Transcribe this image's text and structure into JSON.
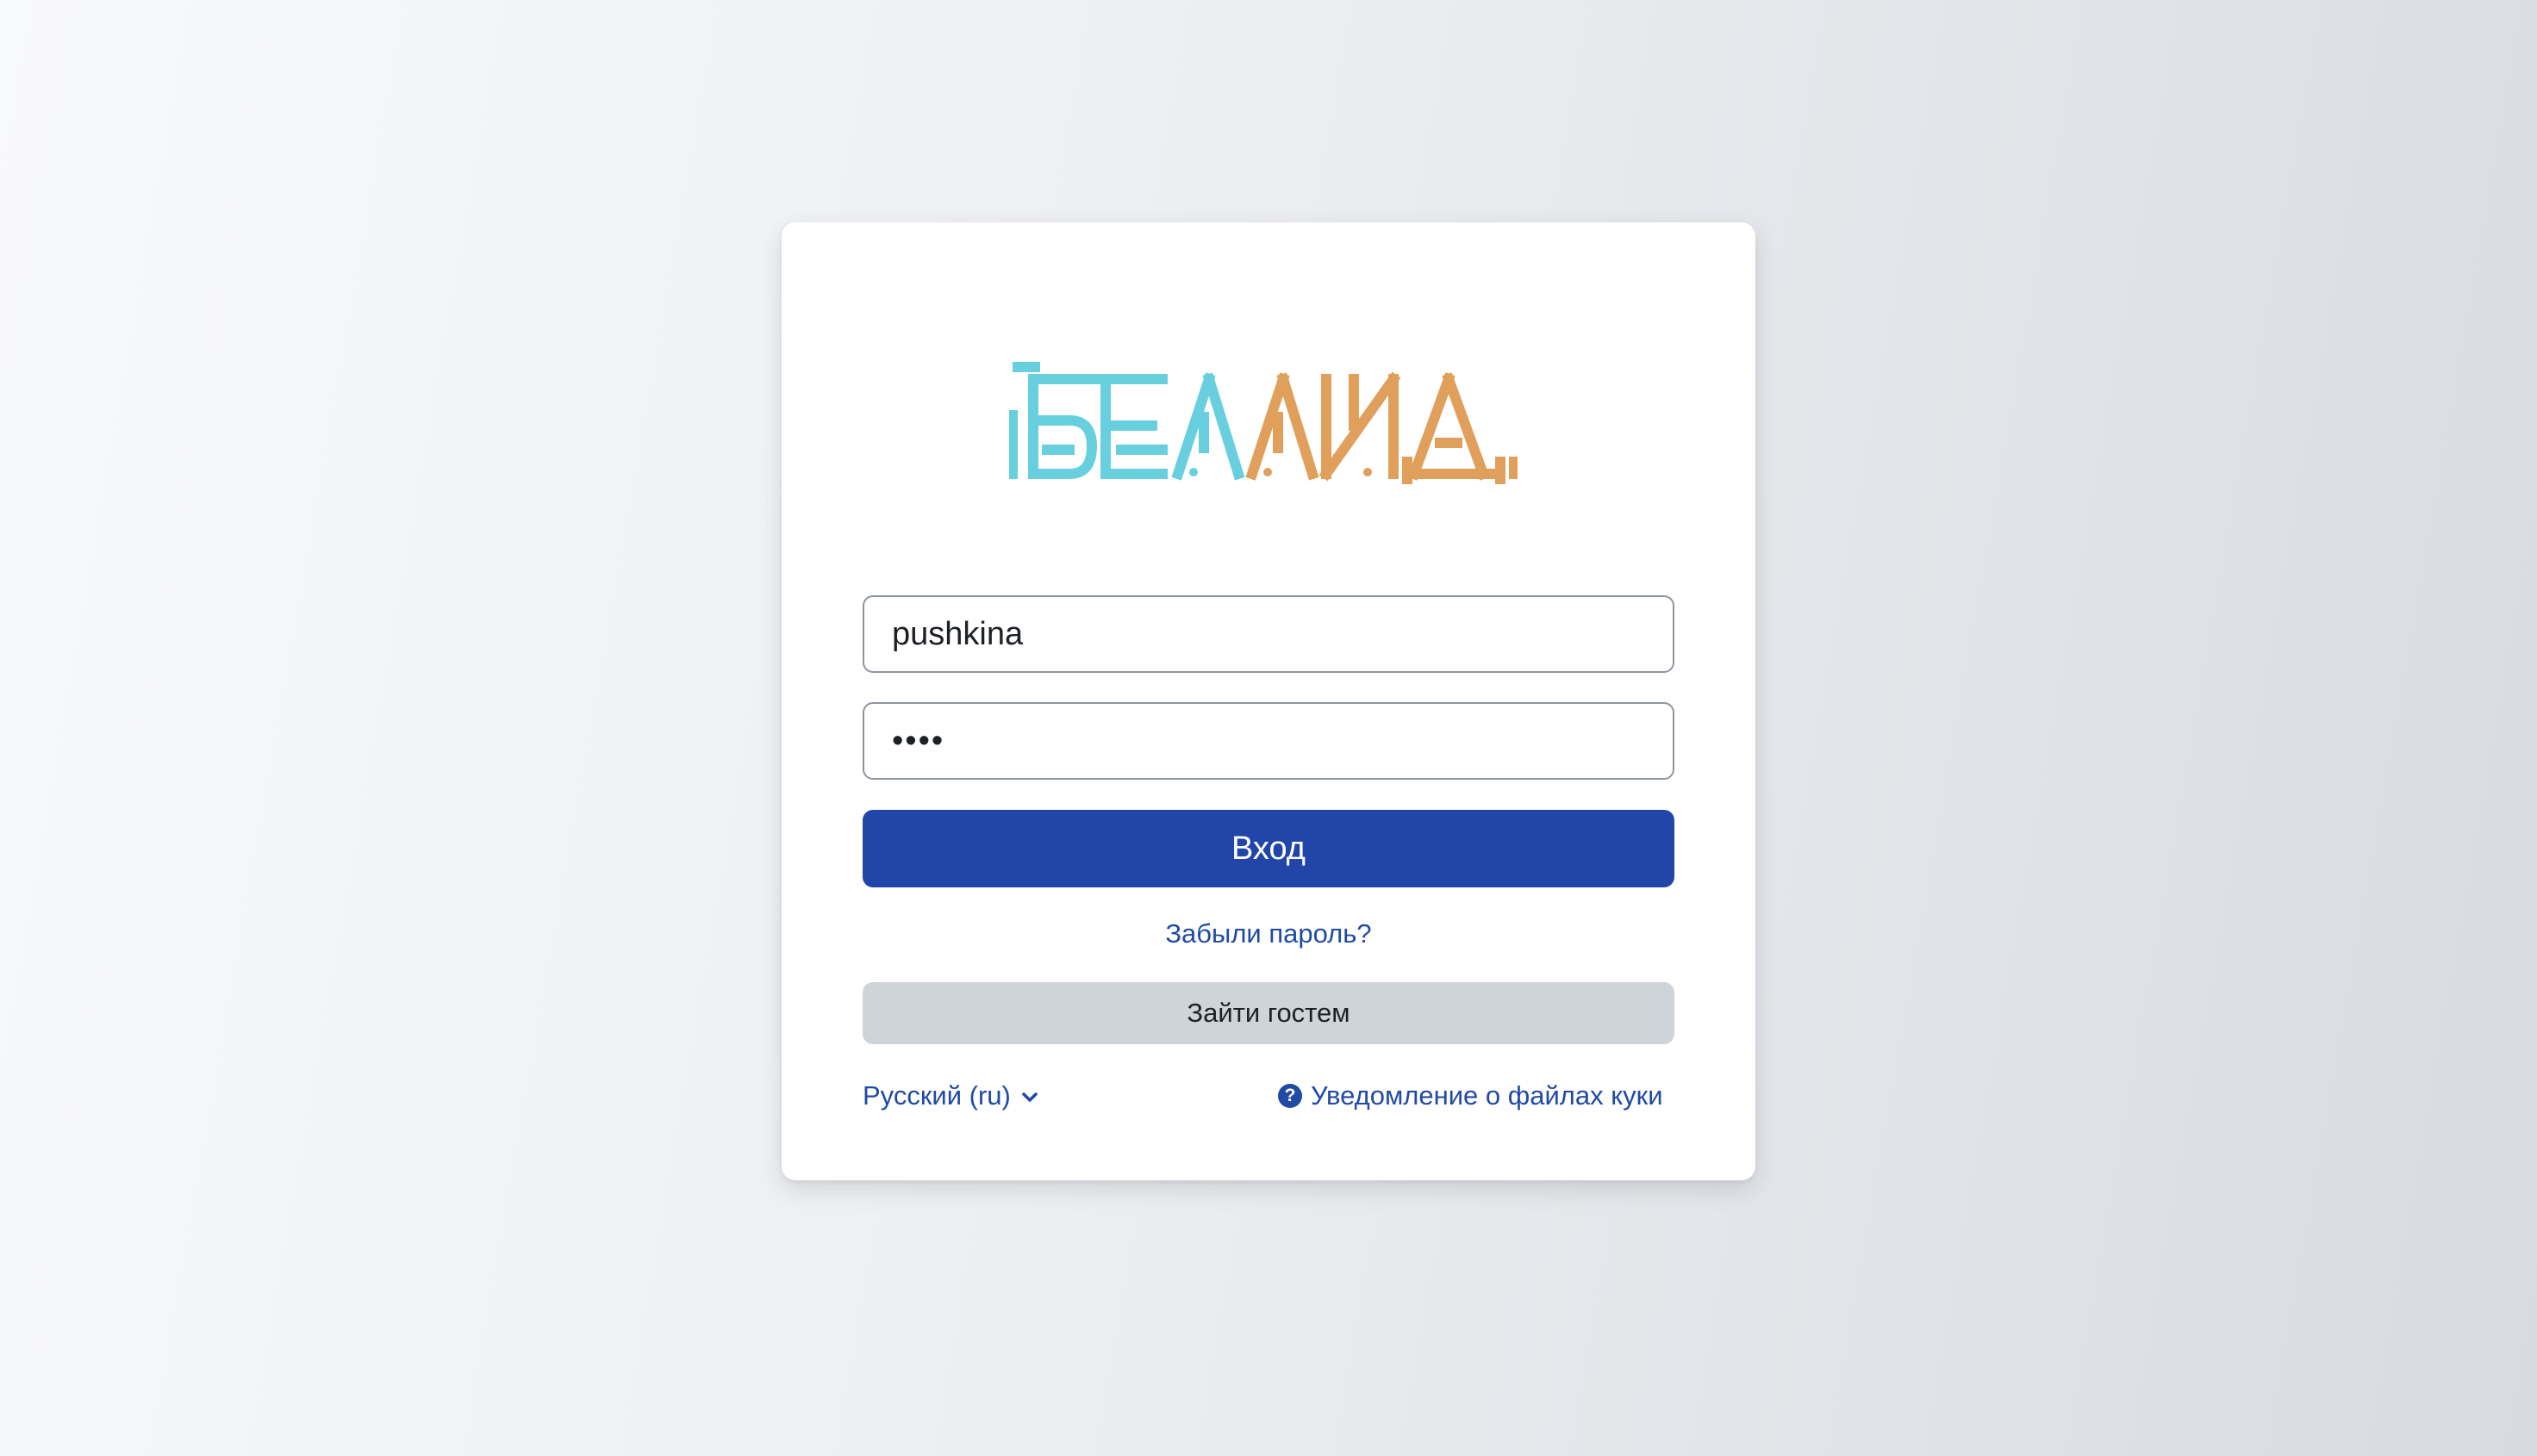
{
  "logo": {
    "text": "БЕЛЛИД",
    "colors": {
      "left": "#68cfdf",
      "right": "#e0a05c"
    }
  },
  "login_form": {
    "username_value": "pushkina",
    "password_value": "••••",
    "login_button_label": "Вход",
    "forgot_password_label": "Забыли пароль?",
    "guest_button_label": "Зайти гостем"
  },
  "footer": {
    "language_label": "Русский (ru)",
    "language_icon": "chevron-down-icon",
    "cookie_notice_label": "Уведомление о файлах куки",
    "cookie_icon": "question-circle-icon"
  },
  "colors": {
    "primary": "#2145a8",
    "link": "#1f4aa6",
    "secondary_button": "#ced4da"
  }
}
